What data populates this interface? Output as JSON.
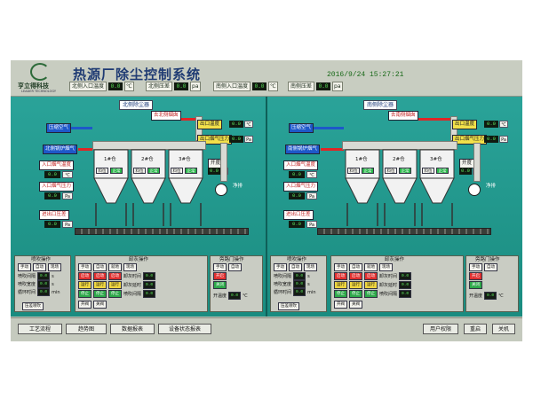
{
  "header": {
    "logo_name": "亨立得科技",
    "logo_sub": "LEADER TECHNOLOGY",
    "title": "热源厂除尘控制系统",
    "datetime": "2016/9/24 15:27:21",
    "readings": [
      {
        "label": "北侧入口温度",
        "value": "0.0",
        "unit": "℃"
      },
      {
        "label": "北侧压差",
        "value": "0.0",
        "unit": "pa"
      },
      {
        "label": "南侧入口温度",
        "value": "0.0",
        "unit": "℃"
      },
      {
        "label": "南侧压差",
        "value": "0.0",
        "unit": "pa"
      }
    ]
  },
  "north": {
    "title": "北侧除尘器",
    "outlet_duct": "去北侧烟囱",
    "outlet_temp": "出口温度",
    "outlet_pressure": "出口烟气压力",
    "compressed_air": "压缩空气",
    "inlet_gas": "北侧锅炉烟气",
    "inlet_temp": "入口烟气温度",
    "inlet_pressure": "入口烟气压力",
    "air_pressure": "进出口压差",
    "silos": [
      "1#仓",
      "2#仓",
      "3#仓"
    ],
    "level": "料位",
    "normal": "正常",
    "open": "开度",
    "fan": "净排",
    "value": "0.0",
    "unit_c": "℃",
    "unit_pa": "Pa",
    "unit_pct": "%"
  },
  "south": {
    "title": "南侧除尘器",
    "outlet_duct": "去南侧烟囱",
    "outlet_temp": "出口温度",
    "outlet_pressure": "出口烟气压力",
    "compressed_air": "压缩空气",
    "inlet_gas": "南侧锅炉烟气",
    "inlet_temp": "入口烟气温度",
    "inlet_pressure": "入口烟气压力",
    "air_pressure": "进出口压差",
    "silos": [
      "1#仓",
      "2#仓",
      "3#仓"
    ],
    "level": "料位",
    "normal": "正常",
    "open": "开度",
    "fan": "净排",
    "value": "0.0",
    "unit_c": "℃",
    "unit_pa": "Pa",
    "unit_pct": "%"
  },
  "controls": {
    "pulse_title": "喷吹操作",
    "ash_title": "卸灰操作",
    "bypass_title": "旁路门操作",
    "manual": "手动",
    "auto": "自动",
    "local": "现场",
    "remote": "就地",
    "start": "启动",
    "stop": "停止",
    "run": "运行",
    "interval": "喷吹间隔",
    "pulse_width": "喷吹宽度",
    "cycle": "循环时间",
    "ash_time": "卸灰时间",
    "delay": "卸灰延时",
    "pressure_btn": "压差喷吹",
    "unit_s": "s",
    "unit_min": "min",
    "open_valve": "开阀",
    "close_valve": "关阀",
    "bypass_open": "开启",
    "bypass_close": "关闭",
    "open_temp": "开温度",
    "value": "0.0",
    "unit_c": "℃"
  },
  "footer": {
    "buttons": [
      "工艺流程",
      "趋势图",
      "数据报表",
      "设备状态报表",
      "用户权限",
      "重启",
      "关机"
    ]
  }
}
